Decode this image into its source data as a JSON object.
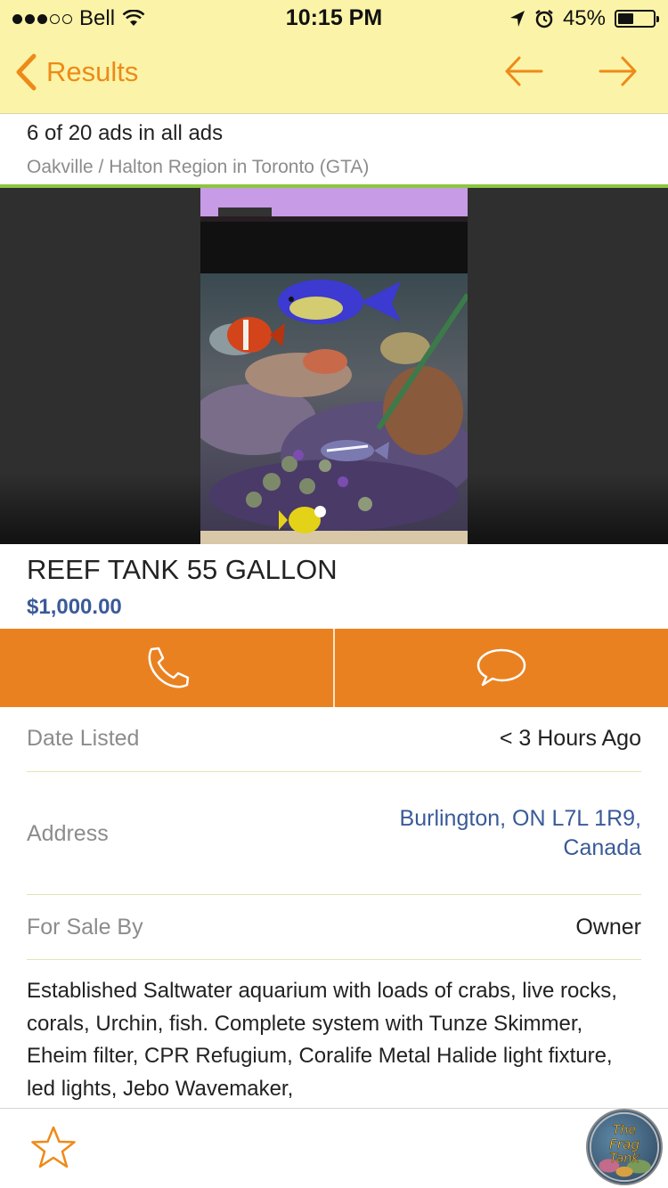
{
  "status": {
    "carrier": "Bell",
    "time": "10:15 PM",
    "battery": "45%",
    "battery_level": 0.45
  },
  "nav": {
    "back_label": "Results"
  },
  "listing_header": {
    "count": "6 of 20 ads in all ads",
    "location": "Oakville / Halton Region in Toronto (GTA)"
  },
  "ad": {
    "title": "REEF TANK 55 GALLON",
    "price": "$1,000.00"
  },
  "details": {
    "date_label": "Date Listed",
    "date_value": "< 3 Hours Ago",
    "address_label": "Address",
    "address_line1": "Burlington, ON L7L 1R9,",
    "address_line2": "Canada",
    "seller_label": "For Sale By",
    "seller_value": "Owner"
  },
  "description": "Established Saltwater aquarium with loads of crabs, live rocks, corals, Urchin, fish. Complete system with Tunze Skimmer, Eheim filter, CPR Refugium, Coralife Metal Halide light fixture, led lights, Jebo Wavemaker,",
  "badge": {
    "line1": "The",
    "line2": "Frag",
    "line3": "Tank"
  },
  "colors": {
    "nav_bg": "#fbf4a8",
    "accent": "#ea8120",
    "link": "#3a5a98",
    "green": "#8cc63f"
  },
  "icons": {
    "back": "chevron-left-icon",
    "prev": "arrow-left-icon",
    "next": "arrow-right-icon",
    "call": "phone-icon",
    "message": "chat-bubble-icon",
    "favorite": "star-icon"
  }
}
